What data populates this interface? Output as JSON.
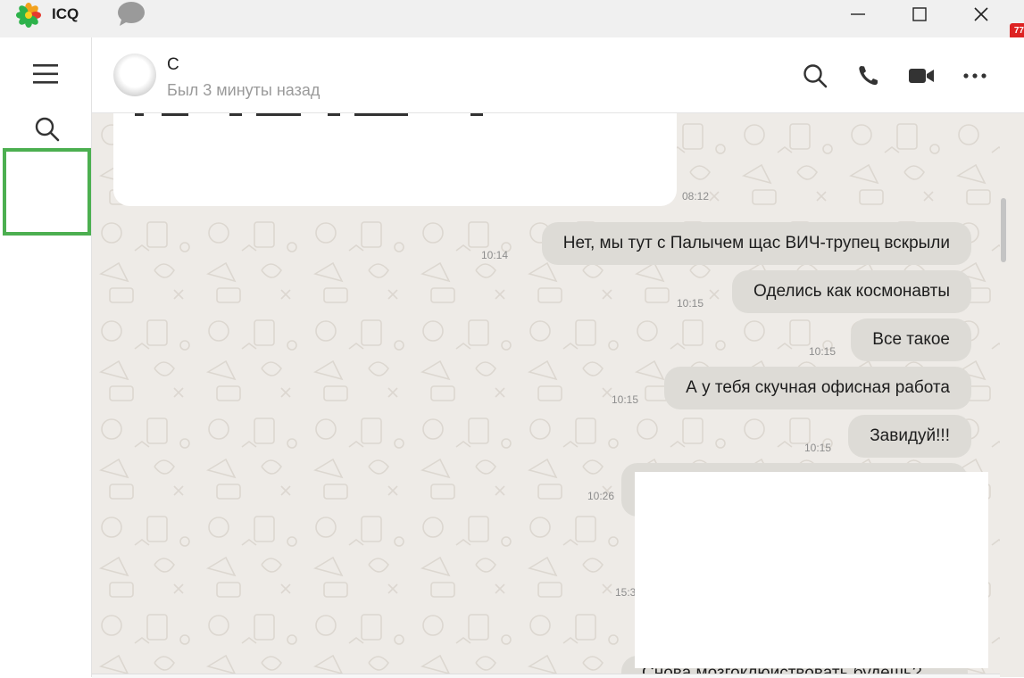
{
  "window": {
    "title": "ICQ",
    "edge_badge_text": "77"
  },
  "icons": {
    "logo": "icq-flower-logo",
    "titlebar_chat": "chat-bubble-icon",
    "minimize": "minimize-icon",
    "maximize": "maximize-icon",
    "close": "close-icon",
    "rail_menu": "hamburger-menu-icon",
    "rail_search": "search-icon",
    "header_search": "search-icon",
    "header_call": "phone-icon",
    "header_video": "video-camera-icon",
    "header_more": "more-dots-icon"
  },
  "header": {
    "contact_name": "С",
    "contact_status": "Был 3 минуты назад"
  },
  "messages": [
    {
      "direction": "in",
      "text": "",
      "time": "08:12"
    },
    {
      "direction": "out",
      "text": "Нет, мы тут с Палычем щас ВИЧ-трупец вскрыли",
      "time": "10:14"
    },
    {
      "direction": "out",
      "text": "Оделись как космонавты",
      "time": "10:15"
    },
    {
      "direction": "out",
      "text": "Все такое",
      "time": "10:15"
    },
    {
      "direction": "out",
      "text": "А у тебя скучная офисная работа",
      "time": "10:15"
    },
    {
      "direction": "out",
      "text": "Завидуй!!!",
      "time": "10:15"
    },
    {
      "direction": "out",
      "text": "",
      "time": "10:26"
    },
    {
      "direction": "out",
      "text": "",
      "time": "15:3"
    },
    {
      "direction": "out",
      "text": "Снова мозгоклюйствовать будешь?",
      "time": ""
    }
  ],
  "colors": {
    "accent_green": "#4caf50",
    "chat_background": "#eeebe7",
    "outgoing_bubble": "#dddbd6",
    "incoming_bubble": "#ffffff"
  }
}
